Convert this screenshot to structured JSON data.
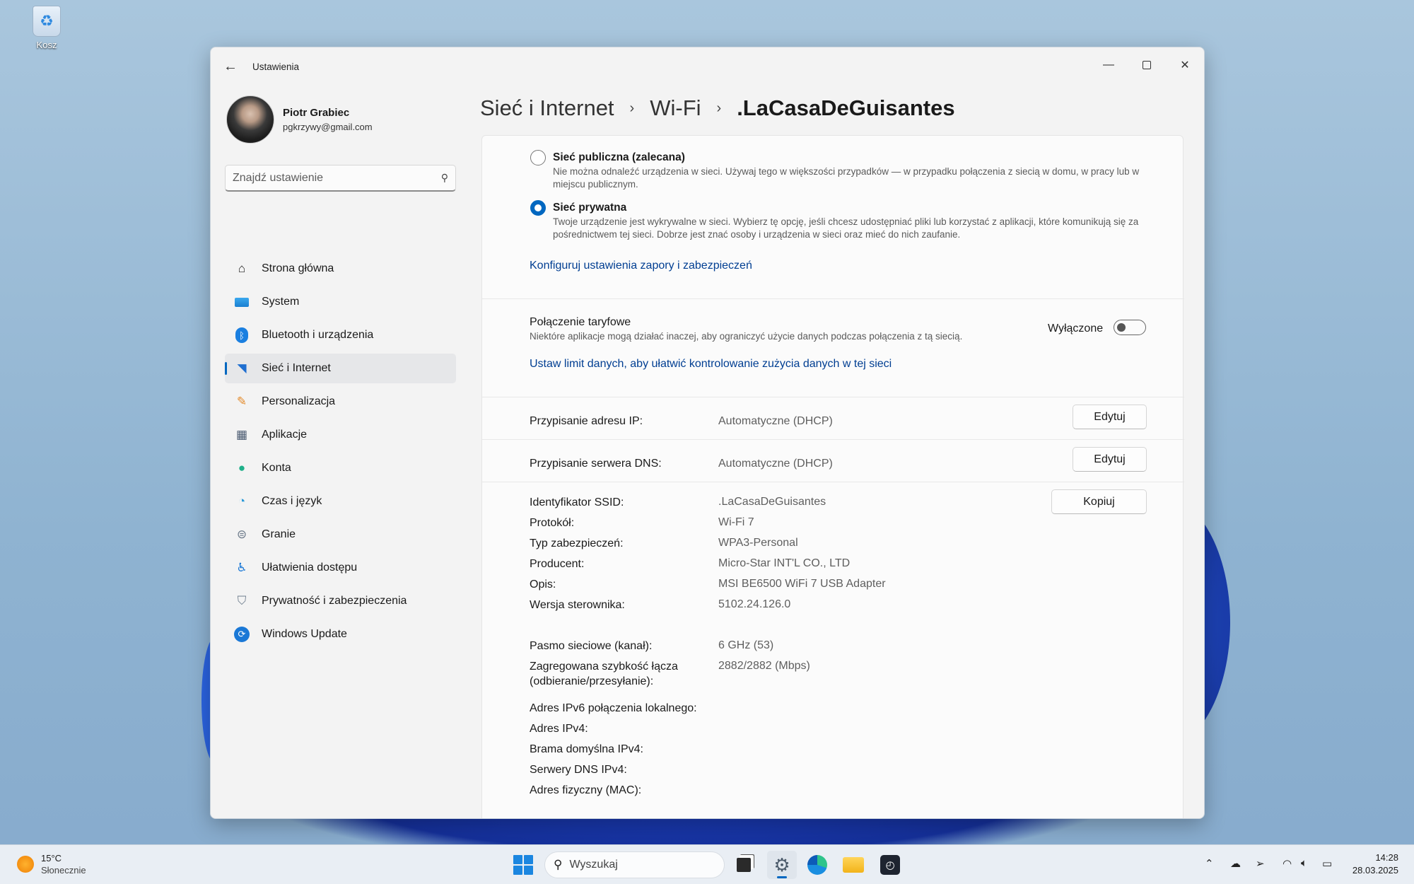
{
  "desktop": {
    "recycle_bin_label": "Kosz"
  },
  "window": {
    "title": "Ustawienia"
  },
  "profile": {
    "name": "Piotr Grabiec",
    "email": "pgkrzywy@gmail.com"
  },
  "search": {
    "placeholder": "Znajdź ustawienie"
  },
  "nav": [
    {
      "label": "Strona główna",
      "icon": "home-icon",
      "color": "#e8822e"
    },
    {
      "label": "System",
      "icon": "monitor-icon",
      "color": "#1a8fd8"
    },
    {
      "label": "Bluetooth i urządzenia",
      "icon": "bluetooth-icon",
      "color": "#1a7fe0"
    },
    {
      "label": "Sieć i Internet",
      "icon": "wifi-icon",
      "color": "#1f6fd0",
      "active": true
    },
    {
      "label": "Personalizacja",
      "icon": "brush-icon",
      "color": "#e38a2a"
    },
    {
      "label": "Aplikacje",
      "icon": "apps-icon",
      "color": "#5a6a80"
    },
    {
      "label": "Konta",
      "icon": "person-icon",
      "color": "#1fb08a"
    },
    {
      "label": "Czas i język",
      "icon": "clock-globe-icon",
      "color": "#2a9ad8"
    },
    {
      "label": "Granie",
      "icon": "gamepad-icon",
      "color": "#6a7888"
    },
    {
      "label": "Ułatwienia dostępu",
      "icon": "accessibility-icon",
      "color": "#1a78d6"
    },
    {
      "label": "Prywatność i zabezpieczenia",
      "icon": "shield-icon",
      "color": "#6d7c8c"
    },
    {
      "label": "Windows Update",
      "icon": "update-icon",
      "color": "#1a78d6"
    }
  ],
  "breadcrumb": {
    "part1": "Sieć i Internet",
    "part2": "Wi-Fi",
    "part3": ".LaCasaDeGuisantes"
  },
  "network_profile": {
    "public_title": "Sieć publiczna (zalecana)",
    "public_desc": "Nie można odnaleźć urządzenia w sieci. Używaj tego w większości przypadków — w przypadku połączenia z siecią w domu, w pracy lub w miejscu publicznym.",
    "private_title": "Sieć prywatna",
    "private_desc": "Twoje urządzenie jest wykrywalne w sieci. Wybierz tę opcję, jeśli chcesz udostępniać pliki lub korzystać z aplikacji, które komunikują się za pośrednictwem tej sieci. Dobrze jest znać osoby i urządzenia w sieci oraz mieć do nich zaufanie.",
    "selected": "private",
    "firewall_link": "Konfiguruj ustawienia zapory i zabezpieczeń"
  },
  "metered": {
    "title": "Połączenie taryfowe",
    "desc": "Niektóre aplikacje mogą działać inaczej, aby ograniczyć użycie danych podczas połączenia z tą siecią.",
    "state_label": "Wyłączone",
    "on": false,
    "data_limit_link": "Ustaw limit danych, aby ułatwić kontrolowanie zużycia danych w tej sieci"
  },
  "ip": {
    "label": "Przypisanie adresu IP:",
    "value": "Automatyczne (DHCP)",
    "button": "Edytuj"
  },
  "dns": {
    "label": "Przypisanie serwera DNS:",
    "value": "Automatyczne (DHCP)",
    "button": "Edytuj"
  },
  "properties": {
    "copy_button": "Kopiuj",
    "rows": [
      {
        "label": "Identyfikator SSID:",
        "value": ".LaCasaDeGuisantes"
      },
      {
        "label": "Protokół:",
        "value": "Wi-Fi 7"
      },
      {
        "label": "Typ zabezpieczeń:",
        "value": "WPA3-Personal"
      },
      {
        "label": "Producent:",
        "value": "Micro-Star INT'L CO., LTD"
      },
      {
        "label": "Opis:",
        "value": "MSI BE6500 WiFi 7 USB Adapter"
      },
      {
        "label": "Wersja sterownika:",
        "value": "5102.24.126.0"
      },
      {
        "label": "Pasmo sieciowe (kanał):",
        "value": "6 GHz (53)"
      },
      {
        "label": "Zagregowana szybkość łącza (odbieranie/przesyłanie):",
        "value": "2882/2882 (Mbps)"
      },
      {
        "label": "Adres IPv6 połączenia lokalnego:",
        "value": ""
      },
      {
        "label": "Adres IPv4:",
        "value": ""
      },
      {
        "label": "Brama domyślna IPv4:",
        "value": ""
      },
      {
        "label": "Serwery DNS IPv4:",
        "value": ""
      },
      {
        "label": "Adres fizyczny (MAC):",
        "value": ""
      }
    ]
  },
  "taskbar": {
    "weather_temp": "15°C",
    "weather_desc": "Słonecznie",
    "search_placeholder": "Wyszukaj",
    "time": "14:28",
    "date": "28.03.2025"
  },
  "colors": {
    "accent": "#0067c0",
    "link": "#003e92"
  }
}
